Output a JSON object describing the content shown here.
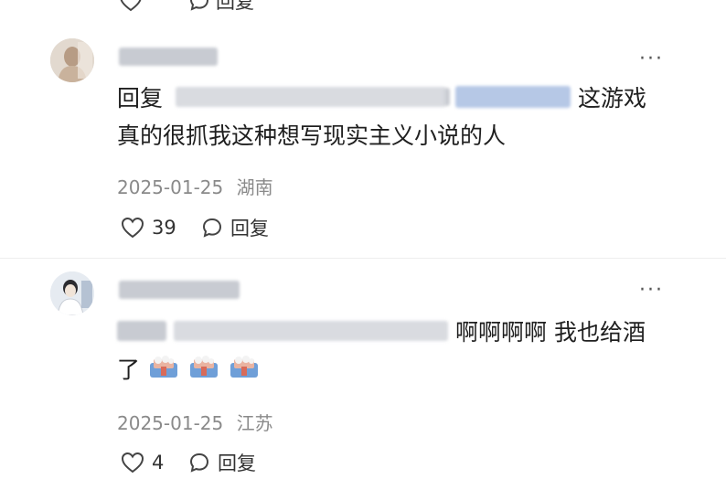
{
  "top_partial": {
    "reply_label": "回复"
  },
  "comments": [
    {
      "reply_prefix": "回复",
      "text_line1_suffix": "这游戏",
      "text_line2": "真的很抓我这种想写现实主义小说的人",
      "date": "2025-01-25",
      "location": "湖南",
      "like_count": "39",
      "reply_label": "回复",
      "more_label": "···"
    },
    {
      "text_line1_suffix": "啊啊啊啊 我也给酒",
      "text_line2_prefix": "了",
      "emoji_count": 3,
      "date": "2025-01-25",
      "location": "江苏",
      "like_count": "4",
      "reply_label": "回复",
      "more_label": "···"
    }
  ],
  "icons": {
    "like": "heart-outline-icon",
    "reply": "speech-bubble-icon",
    "more": "more-dots-icon",
    "emoji": "beer-mug-emoji-icon"
  },
  "colors": {
    "text": "#1f1f1f",
    "meta": "#8a8a8a",
    "background": "#ffffff"
  }
}
